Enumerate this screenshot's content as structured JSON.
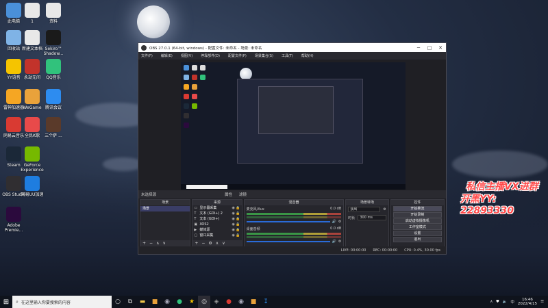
{
  "desktop": {
    "icons": [
      {
        "label": "此电脑",
        "icon": "computer-icon",
        "color": "#4a90d9"
      },
      {
        "label": "1",
        "icon": "file-icon",
        "color": "#e8e8e8"
      },
      {
        "label": "资料",
        "icon": "file-icon",
        "color": "#e8e8e8"
      },
      {
        "label": "回收站",
        "icon": "recycle-bin-icon",
        "color": "#7fb3e6"
      },
      {
        "label": "新建文本档",
        "icon": "text-file-icon",
        "color": "#e8e8e8"
      },
      {
        "label": "Sekiro™\nShadow...",
        "icon": "sekiro-icon",
        "color": "#1a1a1a"
      },
      {
        "label": "YY语音",
        "icon": "yy-icon",
        "color": "#f5c400"
      },
      {
        "label": "永劫无间",
        "icon": "naraka-icon",
        "color": "#c2332b"
      },
      {
        "label": "QQ音乐",
        "icon": "qq-music-icon",
        "color": "#31c27c"
      },
      {
        "label": "雷神加速器",
        "icon": "leishen-icon",
        "color": "#f5a623"
      },
      {
        "label": "WeGame",
        "icon": "wegame-icon",
        "color": "#e9a23b"
      },
      {
        "label": "腾讯会议",
        "icon": "meeting-icon",
        "color": "#2d8cf0"
      },
      {
        "label": "网易云音乐",
        "icon": "netease-music-icon",
        "color": "#d93a32"
      },
      {
        "label": "全民K歌",
        "icon": "kge-icon",
        "color": "#e84a4a"
      },
      {
        "label": "三个萨 ...",
        "icon": "game-icon",
        "color": "#5a3a2a"
      },
      {
        "label": "Steam",
        "icon": "steam-icon",
        "color": "#1b2838"
      },
      {
        "label": "GeForce\nExperience",
        "icon": "geforce-icon",
        "color": "#76b900"
      },
      {
        "label": "OBS Studio",
        "icon": "obs-icon",
        "color": "#302e31"
      },
      {
        "label": "网易UU加速",
        "icon": "uu-icon",
        "color": "#1e7de0"
      },
      {
        "label": "Adobe\nPremie...",
        "icon": "premiere-icon",
        "color": "#2b0a3d"
      }
    ]
  },
  "promo": {
    "line1": "私信主播VX进群",
    "line2": "开黑YY: 22893330"
  },
  "obs": {
    "title": "OBS 27.0.1 (64-bit, windows) - 配置文件: 未命名 - 场景: 未命名",
    "menu": [
      "文件(F)",
      "编辑(E)",
      "视图(V)",
      "停靠部件(D)",
      "配置文件(P)",
      "场景集合(S)",
      "工具(T)",
      "帮助(H)"
    ],
    "scene_label": "未选择源",
    "props_label": "属性",
    "filters_label": "滤镜",
    "docks": {
      "scenes": {
        "header": "场景",
        "items": [
          "场景"
        ]
      },
      "sources": {
        "header": "来源",
        "items": [
          {
            "icon": "display-capture-icon",
            "name": "显示器采集"
          },
          {
            "icon": "text-icon",
            "name": "文本 (GDI+) 2"
          },
          {
            "icon": "text-icon",
            "name": "文本 (GDI+)"
          },
          {
            "icon": "image-icon",
            "name": "XOS2"
          },
          {
            "icon": "media-icon",
            "name": "媒体源"
          },
          {
            "icon": "window-capture-icon",
            "name": "窗口采集"
          }
        ]
      },
      "mixer": {
        "header": "混音器",
        "channels": [
          {
            "name": "麦克风/Aux",
            "db": "0.0 dB"
          },
          {
            "name": "桌面音频",
            "db": "0.0 dB"
          }
        ]
      },
      "transitions": {
        "header": "场景转场",
        "type": "淡出",
        "duration_label": "时长",
        "duration": "300 ms"
      },
      "controls": {
        "header": "控件",
        "buttons": [
          "开始推流",
          "开始录制",
          "启动虚拟摄像机",
          "工作室模式",
          "设置",
          "退出"
        ]
      }
    },
    "status": {
      "live": "LIVE: 00:00:00",
      "rec": "REC: 00:00:00",
      "cpu": "CPU: 0.4%, 30.00 fps"
    }
  },
  "taskbar": {
    "search_placeholder": "在这里输入你要搜索的内容",
    "tray_lang": "中",
    "time": "16:46",
    "date": "2022/4/15"
  }
}
